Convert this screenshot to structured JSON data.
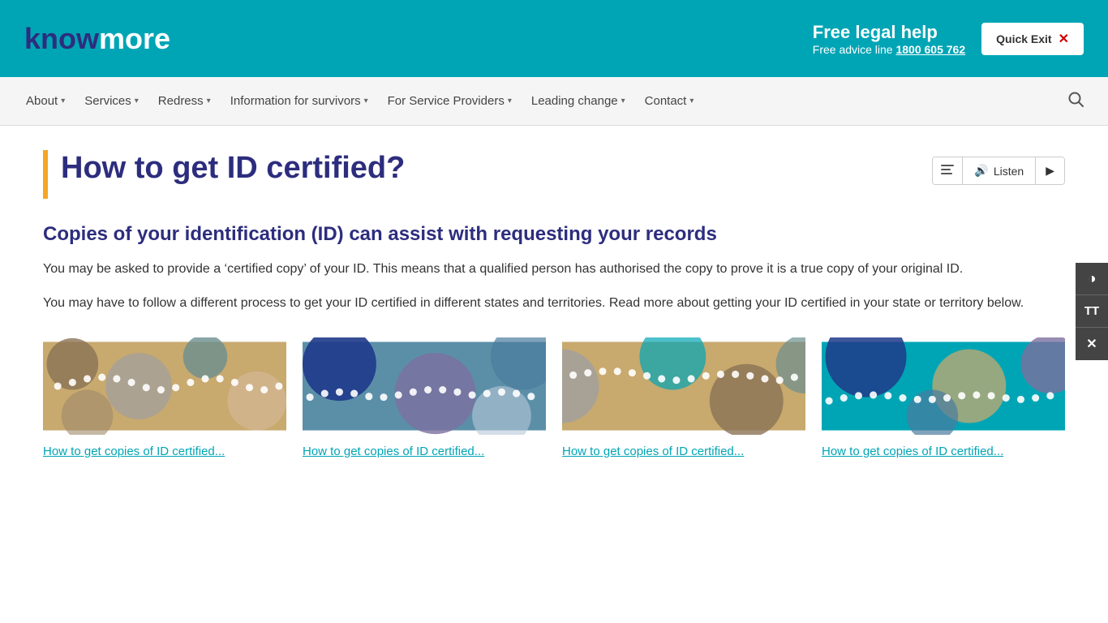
{
  "header": {
    "logo_know": "know",
    "logo_more": "more",
    "free_legal_title": "Free legal help",
    "free_legal_sub": "Free advice line",
    "free_legal_phone": "1800 605 762",
    "quick_exit_label": "Quick Exit"
  },
  "nav": {
    "items": [
      {
        "label": "About",
        "id": "about"
      },
      {
        "label": "Services",
        "id": "services"
      },
      {
        "label": "Redress",
        "id": "redress"
      },
      {
        "label": "Information for survivors",
        "id": "info-survivors"
      },
      {
        "label": "For Service Providers",
        "id": "service-providers"
      },
      {
        "label": "Leading change",
        "id": "leading-change"
      },
      {
        "label": "Contact",
        "id": "contact"
      }
    ]
  },
  "page": {
    "title": "How to get ID certified?",
    "listen_label": "Listen",
    "section_heading": "Copies of your identification (ID) can assist with requesting your records",
    "body_text_1": "You may be asked to provide a ‘certified copy’ of your ID. This means that a qualified person has authorised the copy to prove it is a true copy of your original ID.",
    "body_text_2": "You may have to follow a different process to get your ID certified in different states and territories. Read more about getting your ID certified in your state or territory below."
  },
  "cards": [
    {
      "id": "card1",
      "link_text": "How to get copies of ID certified...",
      "pattern_colors": [
        "#c8a96e",
        "#8b7355",
        "#a0a0a0",
        "#6b8e8e",
        "#d4b896"
      ]
    },
    {
      "id": "card2",
      "link_text": "How to get copies of ID certified...",
      "pattern_colors": [
        "#1e3a8a",
        "#5b8fa8",
        "#7c6f9f",
        "#4a7c9e",
        "#b8c8d8"
      ]
    },
    {
      "id": "card3",
      "link_text": "How to get copies of ID certified...",
      "pattern_colors": [
        "#c8a96e",
        "#a0a0a0",
        "#00a5b5",
        "#8b7355",
        "#6b8e8e"
      ]
    },
    {
      "id": "card4",
      "link_text": "How to get copies of ID certified...",
      "pattern_colors": [
        "#00a5b5",
        "#1e3a8a",
        "#c8a96e",
        "#7c6f9f",
        "#4a7c9e"
      ]
    }
  ],
  "accessibility": {
    "contrast_label": "Toggle contrast",
    "font_size_label": "Toggle font size",
    "close_label": "Close"
  }
}
